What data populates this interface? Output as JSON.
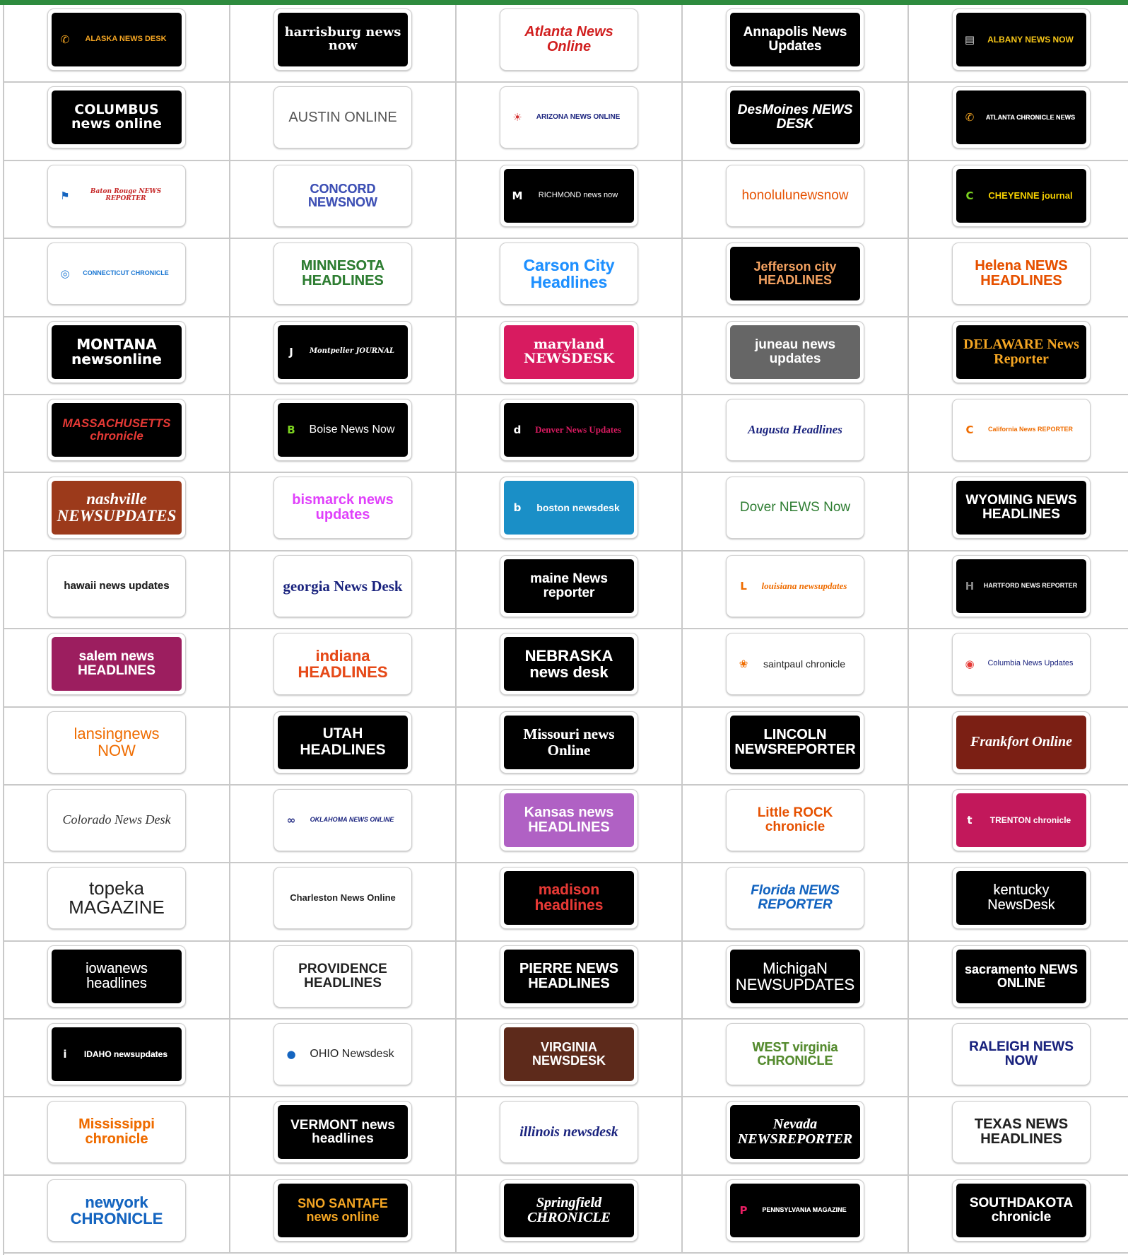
{
  "logos": [
    [
      "ALASKA NEWS DESK",
      "harrisburg news now",
      "Atlanta News Online",
      "Annapolis News Updates",
      "ALBANY NEWS NOW"
    ],
    [
      "COLUMBUS news online",
      "AUSTIN ONLINE",
      "ARIZONA NEWS ONLINE",
      "DesMoines NEWS DESK",
      "ATLANTA CHRONICLE NEWS"
    ],
    [
      "Baton Rouge NEWS REPORTER",
      "CONCORD NEWSNOW",
      "RICHMOND news now",
      "honolulunewsnow",
      "CHEYENNE journal"
    ],
    [
      "CONNECTICUT CHRONICLE",
      "MINNESOTA HEADLINES",
      "Carson City Headlines",
      "Jefferson city HEADLINES",
      "Helena NEWS HEADLINES"
    ],
    [
      "MONTANA newsonline",
      "Montpelier JOURNAL",
      "maryland NEWSDESK",
      "juneau news updates",
      "DELAWARE News Reporter"
    ],
    [
      "MASSACHUSETTS chronicle",
      "Boise News Now",
      "Denver News Updates",
      "Augusta Headlines",
      "California News REPORTER"
    ],
    [
      "nashville NEWSUPDATES",
      "bismarck news updates",
      "boston newsdesk",
      "Dover NEWS Now",
      "WYOMING NEWS HEADLINES"
    ],
    [
      "hawaii news updates",
      "georgia News Desk",
      "maine News reporter",
      "louisiana newsupdates",
      "HARTFORD NEWS REPORTER"
    ],
    [
      "salem news HEADLINES",
      "indiana HEADLINES",
      "NEBRASKA news desk",
      "saintpaul chronicle",
      "Columbia News Updates"
    ],
    [
      "lansingnews NOW",
      "UTAH HEADLINES",
      "Missouri news Online",
      "LINCOLN NEWSREPORTER",
      "Frankfort Online"
    ],
    [
      "Colorado News Desk",
      "OKLAHOMA NEWS ONLINE",
      "Kansas news HEADLINES",
      "Little ROCK chronicle",
      "TRENTON chronicle"
    ],
    [
      "topeka MAGAZINE",
      "Charleston News Online",
      "madison headlines",
      "Florida NEWS REPORTER",
      "kentucky NewsDesk"
    ],
    [
      "iowanews headlines",
      "PROVIDENCE HEADLINES",
      "PIERRE NEWS HEADLINES",
      "MichigaN NEWSUPDATES",
      "sacramento NEWS ONLINE"
    ],
    [
      "IDAHO newsupdates",
      "OHIO Newsdesk",
      "VIRGINIA NEWSDESK",
      "WEST virginia CHRONICLE",
      "RALEIGH NEWS NOW"
    ],
    [
      "Mississippi chronicle",
      "VERMONT news headlines",
      "illinois newsdesk",
      "Nevada NEWSREPORTER",
      "TEXAS NEWS HEADLINES"
    ],
    [
      "newyork CHRONICLE",
      "SNO SANTAFE news online",
      "Springfield CHRONICLE",
      "PENNSYLVANIA MAGAZINE",
      "SOUTHDAKOTA chronicle"
    ]
  ]
}
